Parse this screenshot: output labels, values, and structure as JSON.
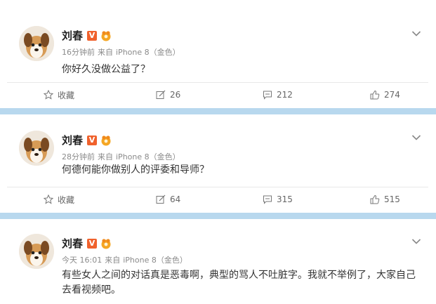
{
  "posts": [
    {
      "author": "刘春",
      "v_badge": "V",
      "time": "16分钟前",
      "source_prefix": "来自",
      "source": "iPhone 8（金色）",
      "content": "你好久没做公益了？",
      "actions": {
        "favorite_label": "收藏",
        "repost": "26",
        "comment": "212",
        "like": "274"
      }
    },
    {
      "author": "刘春",
      "v_badge": "V",
      "time": "28分钟前",
      "source_prefix": "来自",
      "source": "iPhone 8（金色）",
      "content": "何德何能你做别人的评委和导师？",
      "actions": {
        "favorite_label": "收藏",
        "repost": "64",
        "comment": "315",
        "like": "515"
      }
    },
    {
      "author": "刘春",
      "v_badge": "V",
      "time": "今天 16:01",
      "source_prefix": "来自",
      "source": "iPhone 8（金色）",
      "content": "有些女人之间的对话真是恶毒啊，典型的骂人不吐脏字。我就不举例了，大家自己去看视频吧。"
    }
  ],
  "colors": {
    "separator": "#b8d8ee",
    "vip_orange": "#f0612c",
    "meta_gray": "#8a8a8a"
  },
  "icons": [
    "star-icon",
    "repost-icon",
    "comment-icon",
    "thumbs-up-icon",
    "chevron-down-icon",
    "level-badge-icon"
  ]
}
